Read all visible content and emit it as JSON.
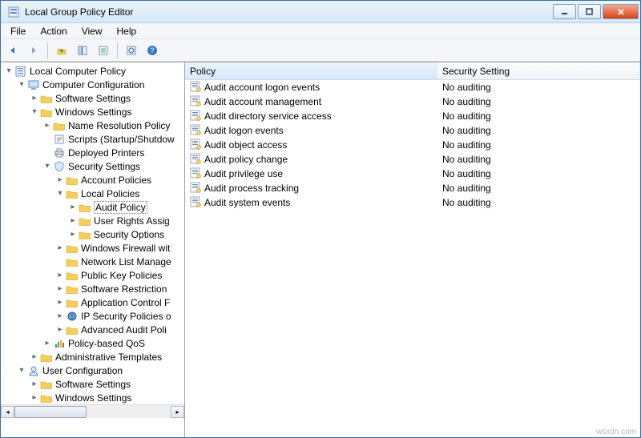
{
  "window": {
    "title": "Local Group Policy Editor"
  },
  "menu": {
    "file": "File",
    "action": "Action",
    "view": "View",
    "help": "Help"
  },
  "toolbar_icons": {
    "back": "back-icon",
    "forward": "forward-icon",
    "up": "up-folder-icon",
    "show_hide": "tree-toggle-icon",
    "export": "export-icon",
    "refresh": "refresh-icon",
    "help": "help-topic-icon"
  },
  "tree": {
    "root": "Local Computer Policy",
    "computer_config": "Computer Configuration",
    "cc_software": "Software Settings",
    "cc_windows": "Windows Settings",
    "cc_name_res": "Name Resolution Policy",
    "cc_scripts": "Scripts (Startup/Shutdow",
    "cc_printers": "Deployed Printers",
    "cc_security": "Security Settings",
    "cc_account_pol": "Account Policies",
    "cc_local_pol": "Local Policies",
    "cc_audit": "Audit Policy",
    "cc_user_rights": "User Rights Assig",
    "cc_sec_options": "Security Options",
    "cc_firewall": "Windows Firewall wit",
    "cc_netlist": "Network List Manage",
    "cc_pubkey": "Public Key Policies",
    "cc_softrestrict": "Software Restriction",
    "cc_appcontrol": "Application Control F",
    "cc_ipsec": "IP Security Policies o",
    "cc_advaudit": "Advanced Audit Poli",
    "cc_qos": "Policy-based QoS",
    "cc_admin_templates": "Administrative Templates",
    "user_config": "User Configuration",
    "uc_software": "Software Settings",
    "uc_windows": "Windows Settings"
  },
  "list": {
    "header_policy": "Policy",
    "header_setting": "Security Setting",
    "rows": [
      {
        "policy": "Audit account logon events",
        "setting": "No auditing"
      },
      {
        "policy": "Audit account management",
        "setting": "No auditing"
      },
      {
        "policy": "Audit directory service access",
        "setting": "No auditing"
      },
      {
        "policy": "Audit logon events",
        "setting": "No auditing"
      },
      {
        "policy": "Audit object access",
        "setting": "No auditing"
      },
      {
        "policy": "Audit policy change",
        "setting": "No auditing"
      },
      {
        "policy": "Audit privilege use",
        "setting": "No auditing"
      },
      {
        "policy": "Audit process tracking",
        "setting": "No auditing"
      },
      {
        "policy": "Audit system events",
        "setting": "No auditing"
      }
    ]
  },
  "watermark": "wsxdn.com"
}
